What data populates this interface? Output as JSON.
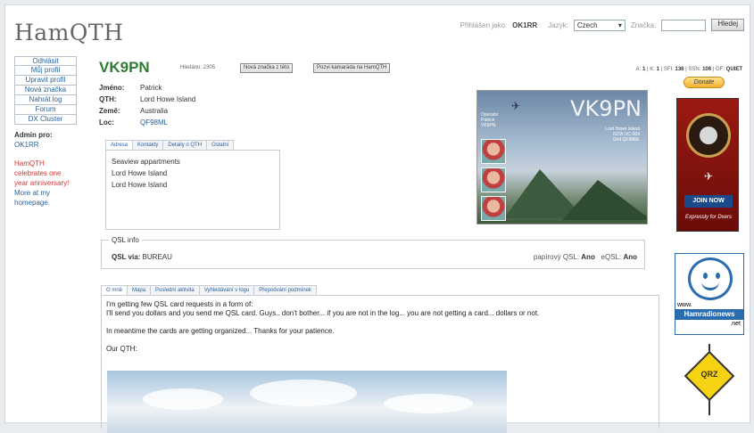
{
  "logo": "HamQTH",
  "header": {
    "logged_label": "Přihlášen jako:",
    "logged_user": "OK1RR",
    "lang_label": "Jazyk:",
    "lang_value": "Czech",
    "search_label": "Značka:",
    "search_value": "",
    "search_button": "Hledej"
  },
  "sidebar": {
    "items": [
      {
        "label": "Odhlásit"
      },
      {
        "label": "Můj profil"
      },
      {
        "label": "Upravit profil"
      },
      {
        "label": "Nová značka"
      },
      {
        "label": "Nahrát log"
      },
      {
        "label": "Forum"
      },
      {
        "label": "DX Cluster"
      }
    ],
    "admin_label": "Admin pro:",
    "admin_call": "OK1RR",
    "anniversary": "HamQTH celebrates one year anniversary!",
    "more": "More at my homepage."
  },
  "profile": {
    "callsign": "VK9PN",
    "searched": "Hledáno: 2305",
    "new_call_button": "Nová značka z této",
    "invite_button": "Pozvi kamaráda na HamQTH",
    "propagation": {
      "prefix": "A: ",
      "a": "1",
      "k_label": " | K: ",
      "k": "1",
      "sfi_label": " | SFI: ",
      "sfi": "136",
      "ssn_label": " | SSN: ",
      "ssn": "106",
      "gf_label": " | GF: ",
      "gf": "QUIET"
    },
    "fields": [
      {
        "key": "Jméno:",
        "value": "Patrick"
      },
      {
        "key": "QTH:",
        "value": "Lord Howe Island"
      },
      {
        "key": "Země:",
        "value": "Australia"
      },
      {
        "key": "Loc:",
        "value": "QF98ML"
      }
    ]
  },
  "qsl_card": {
    "callsign": "VK9PN",
    "small_text": "Lord Howe Island\nIOTA OC-004\nGrid QF98ML",
    "side_text": "Operator\nPatrick\nVK9PN"
  },
  "address_tabs": [
    "Adresa",
    "Kontakty",
    "Detaily o QTH",
    "Ostatní"
  ],
  "address_lines": [
    "Seaview appartments",
    "Lord Howe Island",
    "Lord Howe Island"
  ],
  "qsl_info": {
    "title": "QSL info",
    "via_label": "QSL via:",
    "via_value": "BUREAU",
    "paper_label": "papírový QSL:",
    "paper_value": "Ano",
    "eqsl_label": "eQSL:",
    "eqsl_value": "Ano"
  },
  "about_tabs": [
    "O mně",
    "Mapa",
    "Poslední aktivita",
    "Vyhledávání v logu",
    "Přepodvání podmínek"
  ],
  "about": {
    "p1": "I'm getting few QSL card requests in a form of:",
    "p2": "I'll send you dollars and you send me QSL card.  Guys.. don't bother... if you are not in the log... you are not getting a card... dollars or not.",
    "p3": "In meantime the cards are getting organized...  Thanks for your patience.",
    "p4": "Our QTH:"
  },
  "ads": {
    "donate": "Donate",
    "join": "JOIN NOW",
    "expressly": "Expressly for Dxers",
    "www": "www.",
    "hamradionews": "Hamradionews",
    "net": ".net",
    "qrz": "QRZ"
  }
}
